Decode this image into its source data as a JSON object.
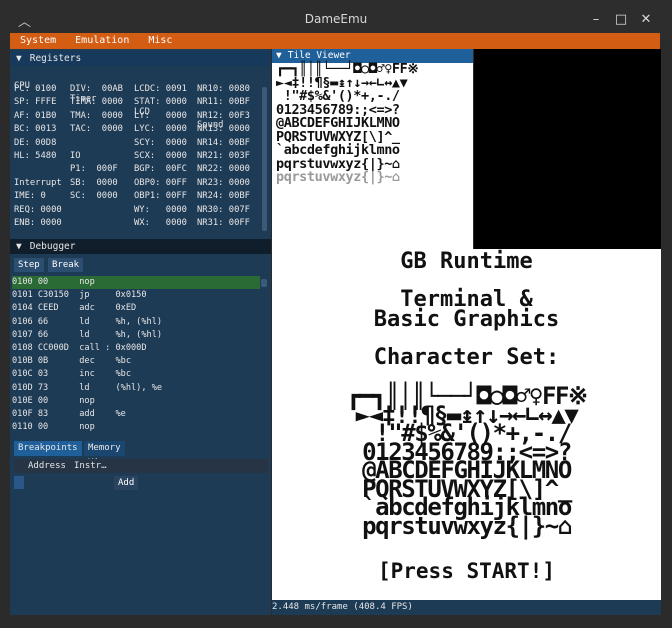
{
  "window": {
    "title": "DameEmu",
    "controls": {
      "minimize": "–",
      "maximize": "□",
      "close": "✕"
    }
  },
  "menu": [
    "System",
    "Emulation",
    "Misc"
  ],
  "registers": {
    "title": "Registers",
    "columns": [
      "CPU",
      "Timer",
      "LCD",
      "Sound"
    ],
    "rows": [
      [
        "PC: 0100",
        "DIV:  00AB",
        "LCDC: 0091",
        "NR10: 0080"
      ],
      [
        "SP: FFFE",
        "TIMA: 0000",
        "STAT: 0000",
        "NR11: 00BF"
      ],
      [
        "AF: 01B0",
        "TMA:  0000",
        "LY:   0000",
        "NR12: 00F3"
      ],
      [
        "BC: 0013",
        "TAC:  0000",
        "LYC:  0000",
        "NR13: 0000"
      ],
      [
        "DE: 00D8",
        "",
        "SCY:  0000",
        "NR14: 00BF"
      ],
      [
        "HL: 5480",
        "IO",
        "SCX:  0000",
        "NR21: 003F"
      ],
      [
        "",
        "P1:  000F",
        "BGP:  00FC",
        "NR22: 0000"
      ],
      [
        "Interrupt",
        "SB:  0000",
        "OBP0: 00FF",
        "NR23: 0000"
      ],
      [
        "IME: 0",
        "SC:  0000",
        "OBP1: 00FF",
        "NR24: 00BF"
      ],
      [
        "REQ: 0000",
        "",
        "WY:   0000",
        "NR30: 007F"
      ],
      [
        "ENB: 0000",
        "",
        "WX:   0000",
        "NR31: 00FF"
      ]
    ]
  },
  "debugger": {
    "title": "Debugger",
    "buttons": {
      "step": "Step",
      "break": "Break"
    },
    "lines": [
      "0100 00      nop",
      "0101 C30150  jp     0x0150",
      "0104 CEED    adc    0xED",
      "0106 66      ld     %h, (%hl)",
      "0107 66      ld     %h, (%hl)",
      "0108 CC000D  call : 0x000D",
      "010B 0B      dec    %bc",
      "010C 03      inc    %bc",
      "010D 73      ld     (%hl), %e",
      "010E 00      nop",
      "010F 83      add    %e",
      "0110 00      nop"
    ],
    "tabs": [
      "Breakpoints",
      "Memory Viewer"
    ],
    "breakpoints_header": [
      "Address",
      "Instr…"
    ],
    "add_button": "Add"
  },
  "tile_viewer": {
    "title": "Tile Viewer",
    "lines": [
      "┏━┓║│║└──┘◘○◘♂♀FF※",
      "►◄‡!!¶§▬↨↑↓→←∟↔▲▼",
      " !\"#$%&'()*+,-./",
      "0123456789:;<=>?",
      "@ABCDEFGHIJKLMNO",
      "PQRSTUVWXYZ[\\]^_",
      "`abcdefghijklmno",
      "pqrstuvwxyz{|}~⌂",
      "pqrstuvwxyz{|}~⌂"
    ]
  },
  "screen": {
    "line1": "GB Runtime",
    "line2": "Terminal &",
    "line3": "Basic Graphics",
    "line4": "Character Set:",
    "charset": [
      "┏━┓║│║└──┘◘○◘♂♀FF※",
      "►◄‡!!¶§▬↨↑↓→←∟↔▲▼",
      " !\"#$%&'()*+,-./",
      "0123456789:;<=>?",
      "@ABCDEFGHIJKLMNO",
      "PQRSTUVWXYZ[\\]^_",
      "`abcdefghijklmno",
      "pqrstuvwxyz{|}~⌂"
    ],
    "prompt": "[Press START!]"
  },
  "status": {
    "frame_time": "2.448 ms/frame (408.4 FPS)"
  }
}
